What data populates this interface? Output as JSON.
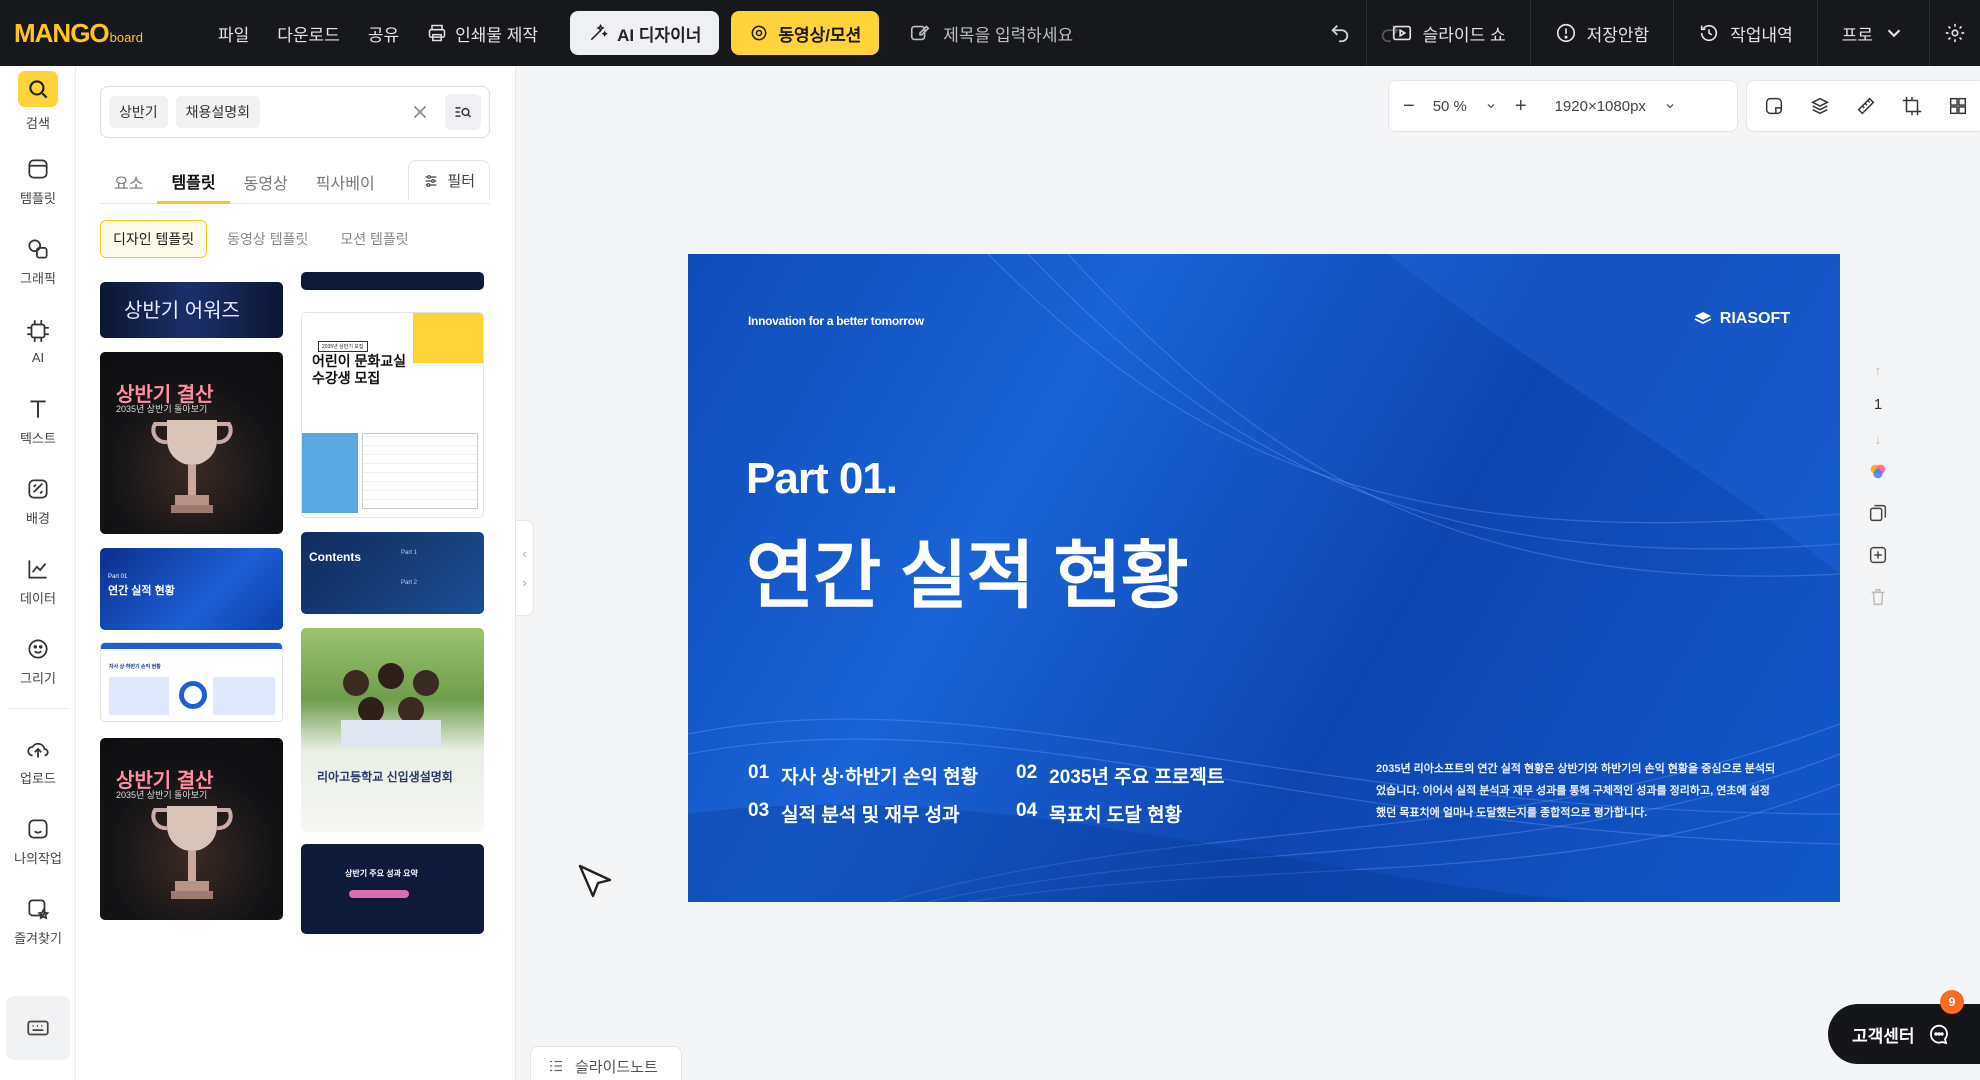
{
  "app": {
    "logo_main": "MANGO",
    "logo_sub": "board"
  },
  "topbar": {
    "menu": [
      "파일",
      "다운로드",
      "공유",
      "인쇄물 제작"
    ],
    "ai_button": "AI 디자이너",
    "video_button": "동영상/모션",
    "title_placeholder": "제목을 입력하세요",
    "slideshow": "슬라이드 쇼",
    "save_status": "저장안함",
    "history": "작업내역",
    "plan": "프로"
  },
  "rail": {
    "items": [
      "검색",
      "템플릿",
      "그래픽",
      "AI",
      "텍스트",
      "배경",
      "데이터",
      "그리기",
      "업로드",
      "나의작업",
      "즐겨찾기"
    ]
  },
  "search": {
    "chips": [
      "상반기",
      "채용설명회"
    ],
    "tabs": [
      "요소",
      "템플릿",
      "동영상",
      "픽사베이"
    ],
    "active_tab": "템플릿",
    "filter": "필터",
    "subtabs": [
      "디자인 템플릿",
      "동영상 템플릿",
      "모션 템플릿"
    ]
  },
  "thumbs": {
    "award": "상반기 어워즈",
    "results_title": "상반기 결산",
    "results_sub": "2035년 상반기 돌아보기",
    "school_small": "2035년 상반기 모집",
    "school_title": "어린이 문화교실 수강생 모집",
    "blue_part": "Part 01",
    "blue_title": "연간 실적 현황",
    "contents": "Contents",
    "contents_part1": "Part 1",
    "contents_part2": "Part 2",
    "report_title": "자사 상·하반기 손익 현황",
    "info_session": "리아고등학교 신입생설명회",
    "summary": "상반기 주요 성과 요약"
  },
  "canvas": {
    "zoom": "50 %",
    "size": "1920×1080px",
    "page": "1"
  },
  "slide": {
    "tag": "Innovation for a better tomorrow",
    "brand": "RIASOFT",
    "part": "Part 01.",
    "headline": "연간 실적 현황",
    "agenda": [
      {
        "num": "01",
        "text": "자사 상·하반기 손익 현황"
      },
      {
        "num": "02",
        "text": "2035년 주요 프로젝트"
      },
      {
        "num": "03",
        "text": "실적 분석 및 재무 성과"
      },
      {
        "num": "04",
        "text": "목표치 도달 현황"
      }
    ],
    "description": "2035년 리아소프트의 연간 실적 현황은 상반기와 하반기의 손익 현황을 중심으로 분석되었습니다. 이어서 실적 분석과 재무 성과를 통해 구체적인 성과를 정리하고, 연초에 설정했던 목표치에 얼마나 도달했는지를 종합적으로 평가합니다."
  },
  "bottom": {
    "notes": "슬라이드노트",
    "help": "고객센터",
    "help_badge": "9"
  },
  "colors": {
    "accent": "#ffc61a",
    "topbar": "#17181b",
    "slide_blue": "#1257c9"
  }
}
